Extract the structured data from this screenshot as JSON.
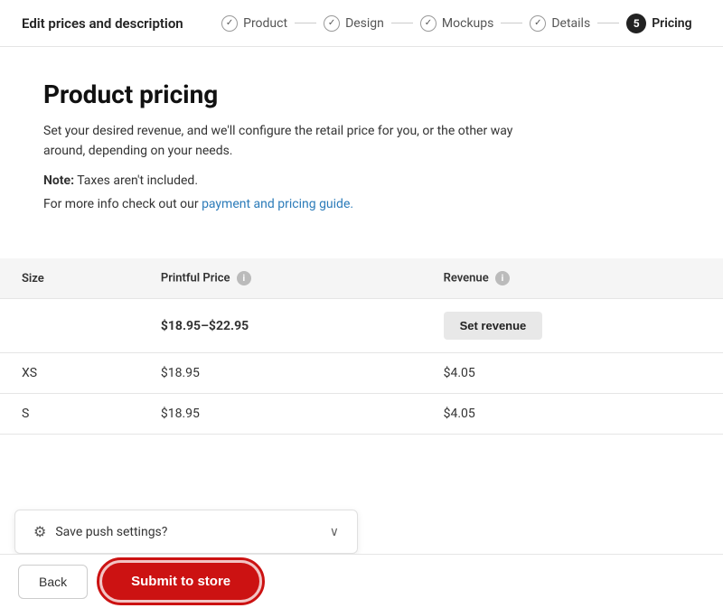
{
  "header": {
    "title": "Edit prices and description",
    "steps": [
      {
        "id": "product",
        "label": "Product",
        "state": "done"
      },
      {
        "id": "design",
        "label": "Design",
        "state": "done"
      },
      {
        "id": "mockups",
        "label": "Mockups",
        "state": "done"
      },
      {
        "id": "details",
        "label": "Details",
        "state": "done"
      },
      {
        "id": "pricing",
        "label": "Pricing",
        "state": "active",
        "number": "5"
      }
    ]
  },
  "main": {
    "page_title": "Product pricing",
    "description": "Set your desired revenue, and we'll configure the retail price for you, or the other way around, depending on your needs.",
    "note_bold": "Note:",
    "note_text": " Taxes aren't included.",
    "info_prefix": "For more info check out our ",
    "info_link_text": "payment and pricing guide.",
    "info_link_href": "#"
  },
  "table": {
    "col_size": "Size",
    "col_price": "Printful Price",
    "col_revenue": "Revenue",
    "bulk_row": {
      "price_range": "$18.95–$22.95",
      "set_revenue_label": "Set revenue"
    },
    "rows": [
      {
        "size": "XS",
        "price": "$18.95",
        "revenue": "$4.05"
      },
      {
        "size": "S",
        "price": "$18.95",
        "revenue": "$4.05"
      }
    ]
  },
  "save_bar": {
    "label": "Save push settings?"
  },
  "footer": {
    "back_label": "Back",
    "submit_label": "Submit to store"
  }
}
